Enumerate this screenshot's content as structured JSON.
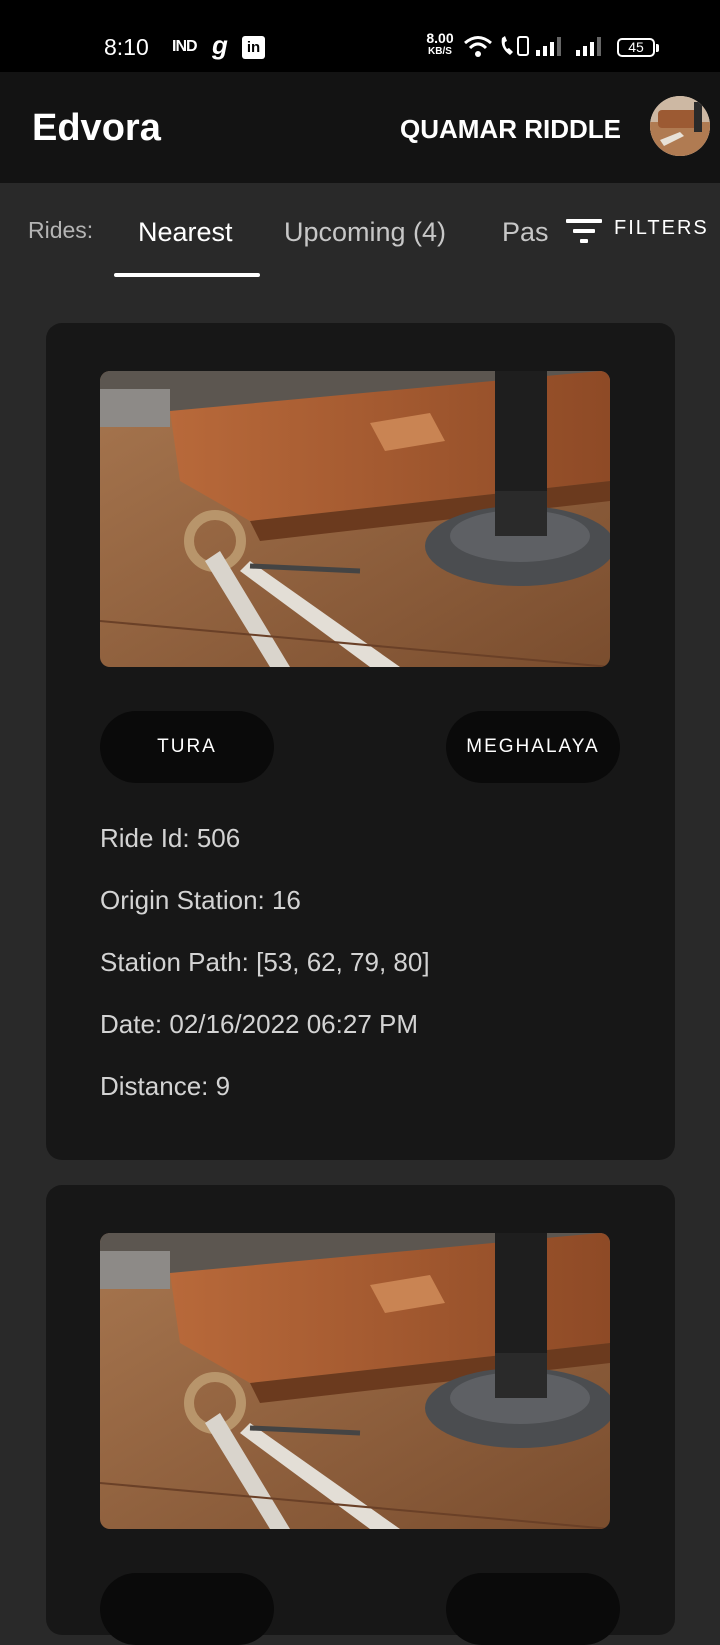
{
  "status_bar": {
    "time": "8:10",
    "carrier_icon": "IND",
    "app_icon_g": "g",
    "app_icon_in": "in",
    "net_speed_value": "8.00",
    "net_speed_unit": "KB/S",
    "battery": "45",
    "icons": [
      "wifi-icon",
      "wifi-calling-icon",
      "signal-icon",
      "signal-icon"
    ]
  },
  "app_bar": {
    "title": "Edvora",
    "user_name": "QUAMAR RIDDLE",
    "avatar_icon": "avatar"
  },
  "tabs": {
    "label": "Rides:",
    "items": [
      {
        "label": "Nearest",
        "active": true
      },
      {
        "label": "Upcoming (4)",
        "active": false
      },
      {
        "label": "Pas",
        "active": false
      }
    ],
    "filters_label": "FILTERS",
    "filters_icon": "filter-icon"
  },
  "rides": [
    {
      "city": "TURA",
      "state": "MEGHALAYA",
      "ride_id": "Ride Id: 506",
      "origin_station": "Origin Station: 16",
      "station_path": "Station Path: [53, 62, 79, 80]",
      "date": "Date: 02/16/2022 06:27 PM",
      "distance": "Distance: 9"
    },
    {
      "city": "",
      "state": ""
    }
  ],
  "colors": {
    "background": "#292929",
    "app_bar": "#131313",
    "card": "#171717",
    "chip": "#0a0a0a"
  }
}
